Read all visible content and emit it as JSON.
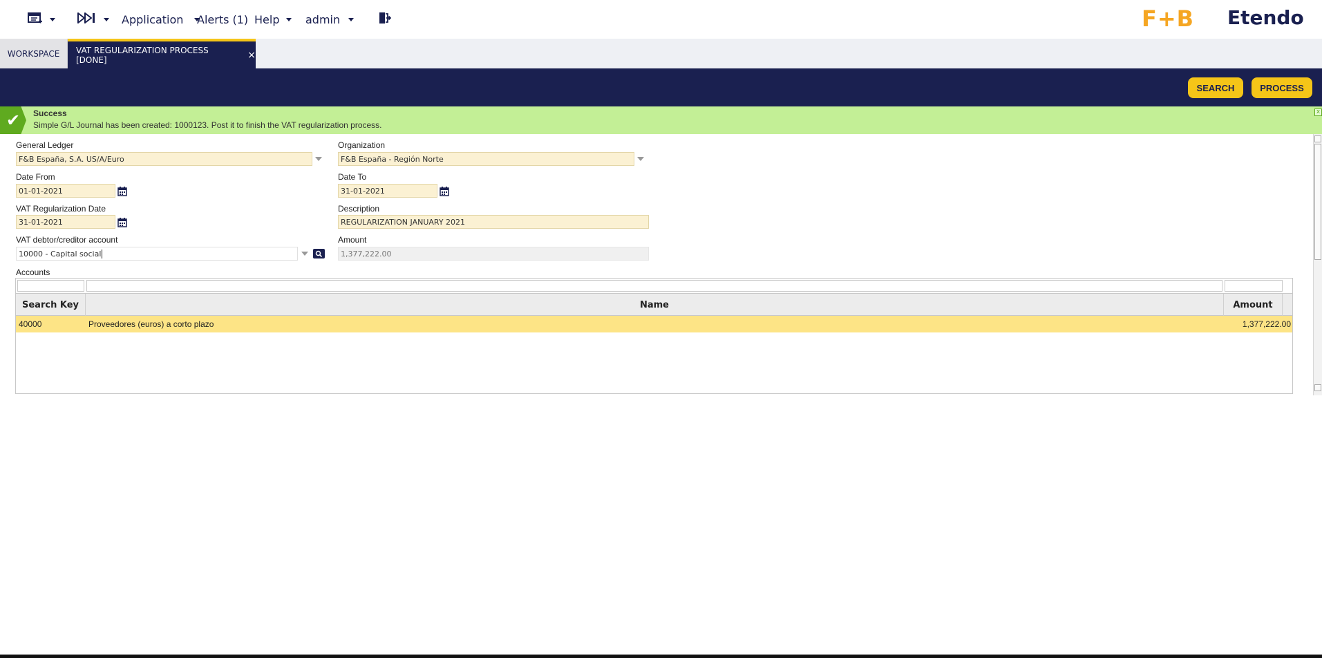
{
  "nav": {
    "menu_icon": "new-window-icon",
    "recent_icon": "fast-forward-icon",
    "application": "Application",
    "alerts": "Alerts (1)",
    "help": "Help",
    "user": "admin",
    "logout_icon": "logout-icon"
  },
  "brand": {
    "fb_logo": "F+B",
    "etendo_logo": "Etendo",
    "fb_color": "#f5a623",
    "primary_color": "#1a2050"
  },
  "tabs": {
    "workspace": "WORKSPACE",
    "active": "VAT REGULARIZATION PROCESS [DONE]",
    "close": "×"
  },
  "toolbar": {
    "search": "SEARCH",
    "process": "PROCESS"
  },
  "message": {
    "title": "Success",
    "text": "Simple G/L Journal has been created: 1000123. Post it to finish the VAT regularization process.",
    "close": "x"
  },
  "form": {
    "general_ledger": {
      "label": "General Ledger",
      "value": "F&B España, S.A. US/A/Euro"
    },
    "organization": {
      "label": "Organization",
      "value": "F&B España - Región Norte"
    },
    "date_from": {
      "label": "Date From",
      "value": "01-01-2021"
    },
    "date_to": {
      "label": "Date To",
      "value": "31-01-2021"
    },
    "vat_reg_date": {
      "label": "VAT Regularization Date",
      "value": "31-01-2021"
    },
    "description": {
      "label": "Description",
      "value": "REGULARIZATION JANUARY 2021"
    },
    "vat_account": {
      "label": "VAT debtor/creditor account",
      "value": "10000 - Capital social"
    },
    "amount": {
      "label": "Amount",
      "value": "1,377,222.00"
    },
    "accounts_label": "Accounts"
  },
  "grid": {
    "columns": {
      "search_key": "Search Key",
      "name": "Name",
      "amount": "Amount"
    },
    "rows": [
      {
        "search_key": "40000",
        "name": "Proveedores (euros) a corto plazo",
        "amount": "1,377,222.00"
      }
    ]
  }
}
